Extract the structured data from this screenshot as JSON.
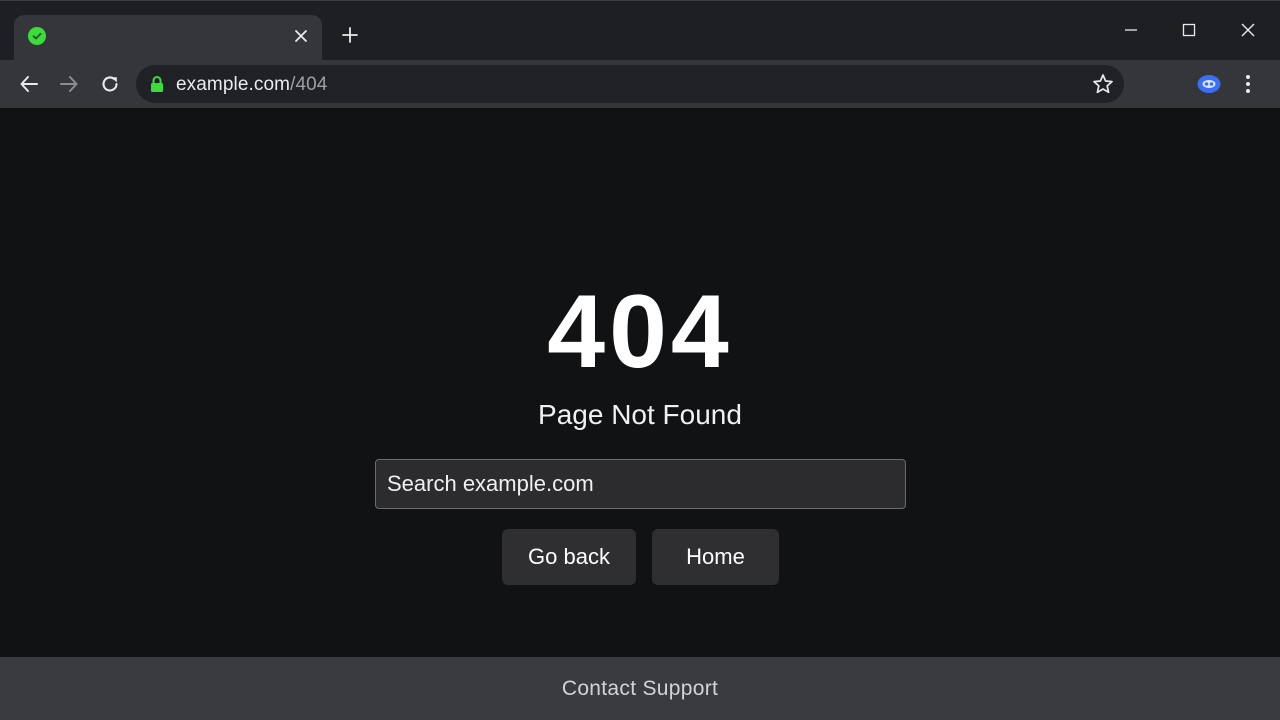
{
  "browser": {
    "tab": {
      "favicon": "check-circle-icon",
      "title": "",
      "close_icon": "close-icon"
    },
    "new_tab_icon": "plus-icon",
    "window_controls": [
      "minimize-icon",
      "maximize-icon",
      "close-icon"
    ],
    "toolbar": {
      "back_icon": "arrow-left-icon",
      "forward_icon": "arrow-right-icon",
      "reload_icon": "reload-icon",
      "lock_icon": "lock-icon",
      "url_host": "example.com",
      "url_path": "/404",
      "bookmark_icon": "star-icon",
      "extension_icon": "extension-icon",
      "menu_icon": "kebab-menu-icon"
    }
  },
  "page": {
    "error_code": "404",
    "title": "Page Not Found",
    "search": {
      "placeholder": "Search example.com",
      "value": ""
    },
    "buttons": {
      "back_label": "Go back",
      "home_label": "Home"
    },
    "footer": {
      "link_label": "Contact Support"
    }
  },
  "colors": {
    "page_background": "#111214",
    "tab_active": "#35363a",
    "favicon_green": "#3ddc3d",
    "lock_green": "#3ddc3d",
    "extension_blue": "#3b6ef5",
    "button_background": "#2f2f31",
    "footer_background": "#3a3b3e"
  }
}
